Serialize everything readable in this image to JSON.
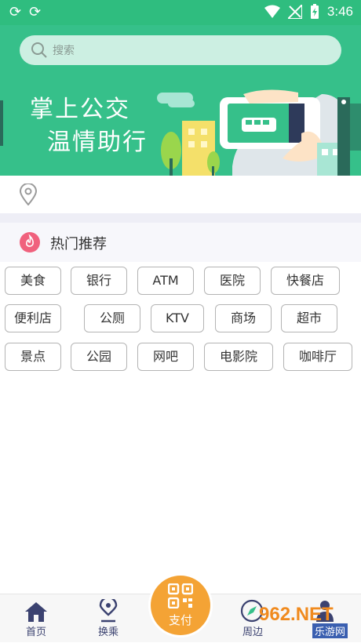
{
  "status_bar": {
    "time": "3:46"
  },
  "search": {
    "placeholder": "搜索"
  },
  "banner": {
    "line1": "掌上公交",
    "line2": "温情助行"
  },
  "hot": {
    "title": "热门推荐"
  },
  "tags": [
    "美食",
    "银行",
    "ATM",
    "医院",
    "快餐店",
    "便利店",
    "公厕",
    "KTV",
    "商场",
    "超市",
    "景点",
    "公园",
    "网吧",
    "电影院",
    "咖啡厅"
  ],
  "tabbar": {
    "home": "首页",
    "transfer": "换乘",
    "pay": "支付",
    "nearby": "周边"
  },
  "watermark": {
    "brand": "962.NET",
    "sub": "乐游网"
  },
  "colors": {
    "primary": "#36c08a",
    "status": "#2fbd7f",
    "pay": "#f4a335",
    "hot_icon": "#f0617d",
    "tab_icon": "#3b4270"
  }
}
